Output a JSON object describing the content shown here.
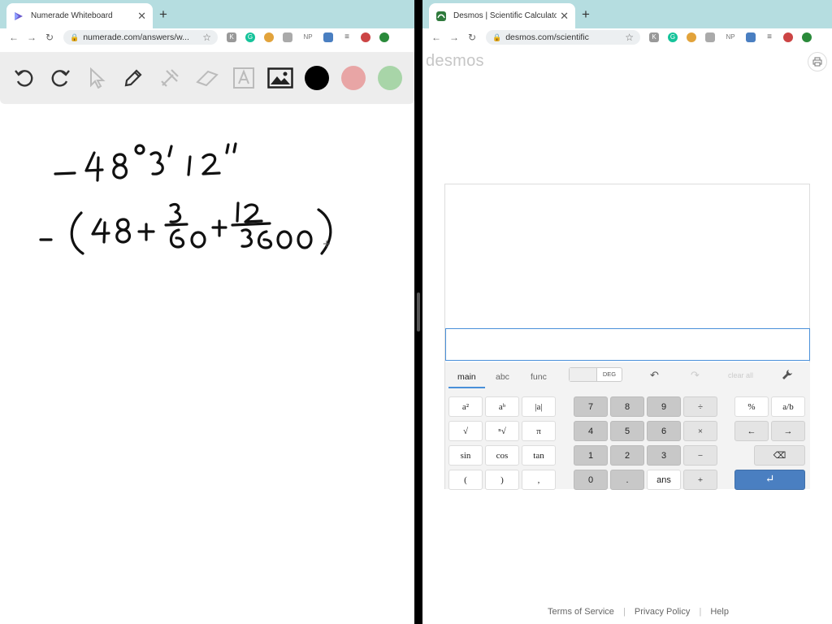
{
  "left": {
    "tab_title": "Numerade Whiteboard",
    "url": "numerade.com/answers/w...",
    "extensions": [
      "K",
      "G",
      "",
      "",
      "NP",
      "",
      "",
      "",
      ""
    ]
  },
  "right": {
    "tab_title": "Desmos | Scientific Calculator",
    "url": "desmos.com/scientific",
    "extensions": [
      "K",
      "G",
      "",
      "",
      "NP",
      "",
      "",
      "",
      ""
    ],
    "logo": "desmos",
    "keypad": {
      "tabs": [
        "main",
        "abc",
        "func"
      ],
      "active_tab": "main",
      "angle_mode": "DEG",
      "clear_all": "clear all",
      "rows": [
        [
          "a²",
          "aᵇ",
          "|a|",
          "7",
          "8",
          "9",
          "÷",
          "%",
          "a/b"
        ],
        [
          "√",
          "ⁿ√",
          "π",
          "4",
          "5",
          "6",
          "×",
          "←",
          "→"
        ],
        [
          "sin",
          "cos",
          "tan",
          "1",
          "2",
          "3",
          "−",
          "",
          "⌫"
        ],
        [
          "(",
          ")",
          ",",
          "0",
          ".",
          "ans",
          "+",
          "",
          "↵"
        ]
      ]
    },
    "footer": [
      "Terms of Service",
      "|",
      "Privacy Policy",
      "|",
      "Help"
    ]
  },
  "colors": {
    "tabstrip": "#b5dde0",
    "accent_blue": "#4a7fc1",
    "color_black": "#000000",
    "color_pink": "#e8a5a5",
    "color_green": "#a8d5a8"
  }
}
